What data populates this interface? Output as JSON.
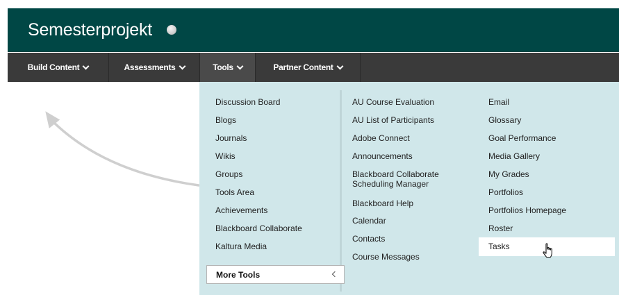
{
  "header": {
    "course_title": "Semesterprojekt"
  },
  "nav": {
    "items": [
      {
        "label": "Build Content"
      },
      {
        "label": "Assessments"
      },
      {
        "label": "Tools"
      },
      {
        "label": "Partner Content"
      }
    ]
  },
  "tools_menu": {
    "column1": [
      "Discussion Board",
      "Blogs",
      "Journals",
      "Wikis",
      "Groups",
      "Tools Area",
      "Achievements",
      "Blackboard Collaborate",
      "Kaltura Media"
    ],
    "more_tools_label": "More Tools",
    "column2": [
      "AU Course Evaluation",
      "AU List of Participants",
      "Adobe Connect",
      "Announcements",
      "Blackboard Collaborate Scheduling Manager",
      "Blackboard Help",
      "Calendar",
      "Contacts",
      "Course Messages"
    ],
    "column3": [
      "Email",
      "Glossary",
      "Goal Performance",
      "Media Gallery",
      "My Grades",
      "Portfolios",
      "Portfolios Homepage",
      "Roster",
      "Tasks"
    ]
  },
  "colors": {
    "header_bg": "#004745",
    "nav_bg": "#3a3a3a",
    "menu_bg": "#d0e7ea"
  },
  "icons": {
    "status": "status-dot-icon",
    "cursor": "hand-pointer-icon",
    "arrow": "curved-arrow-icon"
  }
}
